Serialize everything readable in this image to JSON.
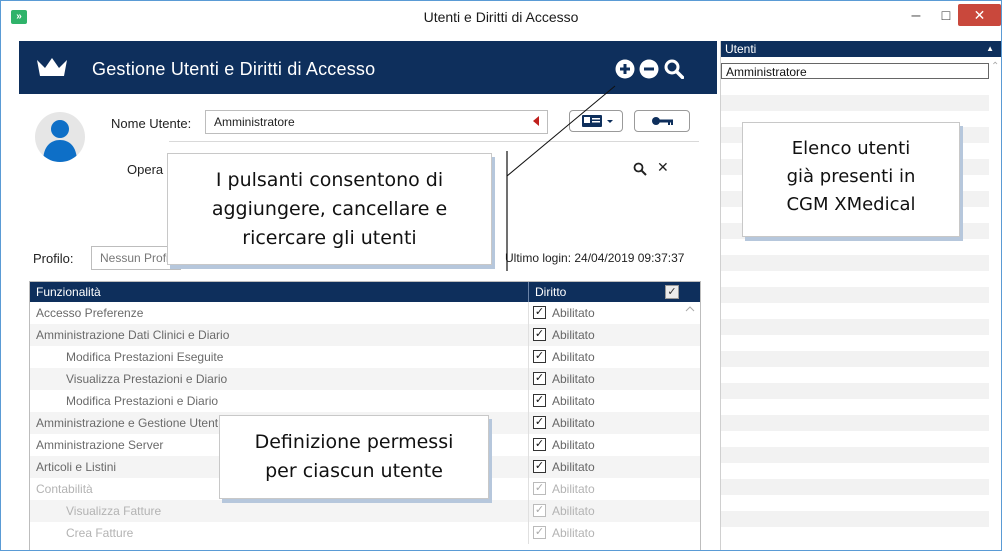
{
  "window": {
    "title": "Utenti e Diritti di Accesso",
    "minimize": "–",
    "maximize": "☐",
    "close": "✕"
  },
  "header": {
    "title": "Gestione Utenti e Diritti di Accesso",
    "icons": [
      "crown-icon",
      "add-icon",
      "remove-icon",
      "search-icon"
    ]
  },
  "form": {
    "user_label": "Nome Utente:",
    "user_value": "Amministratore",
    "operator_label": "Opera",
    "profile_label": "Profilo:",
    "profile_value": "Nessun Profil",
    "last_login": "Ultimo login: 24/04/2019 09:37:37"
  },
  "table": {
    "col_function": "Funzionalità",
    "col_right": "Diritto",
    "rows": [
      {
        "name": "Accesso Preferenze",
        "value": "Abilitato",
        "indent": 0,
        "dim": false
      },
      {
        "name": "Amministrazione Dati Clinici e Diario",
        "value": "Abilitato",
        "indent": 0,
        "dim": false
      },
      {
        "name": "Modifica Prestazioni Eseguite",
        "value": "Abilitato",
        "indent": 1,
        "dim": false
      },
      {
        "name": "Visualizza Prestazioni e Diario",
        "value": "Abilitato",
        "indent": 1,
        "dim": false
      },
      {
        "name": "Modifica Prestazioni e Diario",
        "value": "Abilitato",
        "indent": 1,
        "dim": false
      },
      {
        "name": "Amministrazione e Gestione Utent",
        "value": "Abilitato",
        "indent": 0,
        "dim": false
      },
      {
        "name": "Amministrazione Server",
        "value": "Abilitato",
        "indent": 0,
        "dim": false
      },
      {
        "name": "Articoli e Listini",
        "value": "Abilitato",
        "indent": 0,
        "dim": false
      },
      {
        "name": "Contabilità",
        "value": "Abilitato",
        "indent": 0,
        "dim": true
      },
      {
        "name": "Visualizza Fatture",
        "value": "Abilitato",
        "indent": 1,
        "dim": true
      },
      {
        "name": "Crea Fatture",
        "value": "Abilitato",
        "indent": 1,
        "dim": true
      }
    ]
  },
  "users_panel": {
    "title": "Utenti",
    "users": [
      "Amministratore"
    ]
  },
  "callouts": {
    "buttons": [
      "I pulsanti consentono di",
      "aggiungere, cancellare e",
      "ricercare gli utenti"
    ],
    "users_list": [
      "Elenco utenti",
      "già presenti in",
      "CGM XMedical"
    ],
    "permissions": [
      "Definizione permessi",
      "per ciascun utente"
    ]
  },
  "colors": {
    "header_bg": "#0e2f5c",
    "close_bg": "#c9483c",
    "required_marker": "#c0201d"
  }
}
